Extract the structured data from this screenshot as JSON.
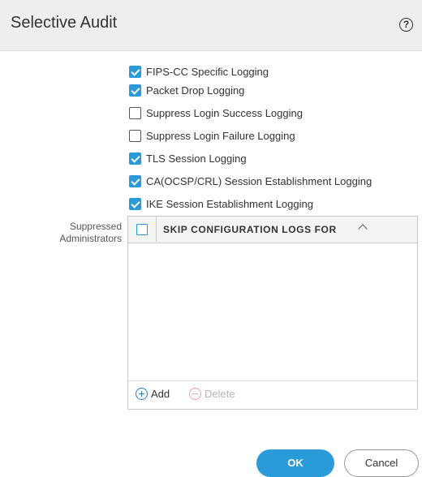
{
  "dialog": {
    "title": "Selective Audit",
    "help_icon_glyph": "?"
  },
  "options": [
    {
      "label": "FIPS-CC Specific Logging",
      "checked": true
    },
    {
      "label": "Packet Drop Logging",
      "checked": true
    },
    {
      "label": "Suppress Login Success Logging",
      "checked": false
    },
    {
      "label": "Suppress Login Failure Logging",
      "checked": false
    },
    {
      "label": "TLS Session Logging",
      "checked": true
    },
    {
      "label": "CA(OCSP/CRL) Session Establishment Logging",
      "checked": true
    },
    {
      "label": "IKE Session Establishment Logging",
      "checked": true
    }
  ],
  "suppressed_admins": {
    "label_line1": "Suppressed",
    "label_line2": "Administrators",
    "column_header": "SKIP CONFIGURATION LOGS FOR",
    "rows": [],
    "add_label": "Add",
    "delete_label": "Delete"
  },
  "buttons": {
    "ok": "OK",
    "cancel": "Cancel"
  },
  "colors": {
    "accent": "#2a9ad8",
    "header_bg": "#eeeeee",
    "delete_disabled": "#f0a0a0"
  }
}
